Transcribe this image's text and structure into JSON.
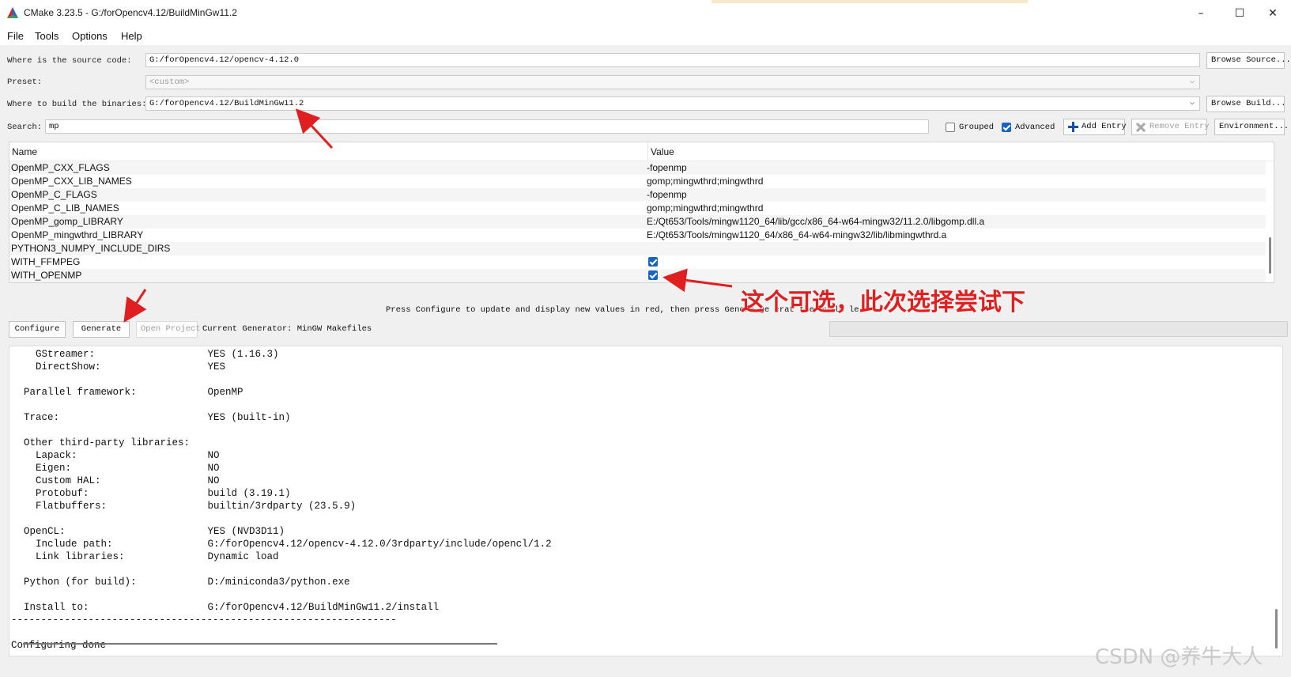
{
  "window": {
    "title": "CMake 3.23.5 - G:/forOpencv4.12/BuildMinGw11.2",
    "minimize": "–",
    "maximize": "☐",
    "close": "✕"
  },
  "menu": [
    "File",
    "Tools",
    "Options",
    "Help"
  ],
  "form": {
    "source_label": "Where is the source code:",
    "source_value": "G:/forOpencv4.12/opencv-4.12.0",
    "browse_source": "Browse Source...",
    "preset_label": "Preset:",
    "preset_value": "<custom>",
    "binaries_label": "Where to build the binaries:",
    "binaries_value": "G:/forOpencv4.12/BuildMinGw11.2",
    "browse_build": "Browse Build...",
    "search_label": "Search:",
    "search_value": "mp",
    "grouped_label": "Grouped",
    "grouped_checked": false,
    "advanced_label": "Advanced",
    "advanced_checked": true,
    "add_entry": "Add Entry",
    "remove_entry": "Remove Entry",
    "environment": "Environment..."
  },
  "table": {
    "col_name": "Name",
    "col_value": "Value",
    "rows": [
      {
        "name": "OpenMP_CXX_FLAGS",
        "value": "-fopenmp"
      },
      {
        "name": "OpenMP_CXX_LIB_NAMES",
        "value": "gomp;mingwthrd;mingwthrd"
      },
      {
        "name": "OpenMP_C_FLAGS",
        "value": "-fopenmp"
      },
      {
        "name": "OpenMP_C_LIB_NAMES",
        "value": "gomp;mingwthrd;mingwthrd"
      },
      {
        "name": "OpenMP_gomp_LIBRARY",
        "value": "E:/Qt653/Tools/mingw1120_64/lib/gcc/x86_64-w64-mingw32/11.2.0/libgomp.dll.a"
      },
      {
        "name": "OpenMP_mingwthrd_LIBRARY",
        "value": "E:/Qt653/Tools/mingw1120_64/x86_64-w64-mingw32/lib/libmingwthrd.a"
      },
      {
        "name": "PYTHON3_NUMPY_INCLUDE_DIRS",
        "value": ""
      },
      {
        "name": "WITH_FFMPEG",
        "value": "",
        "checkbox": true
      },
      {
        "name": "WITH_OPENMP",
        "value": "",
        "checkbox": true
      }
    ]
  },
  "status": {
    "press_text": "Press Configure to update and display new values in red, then press Genera    ge  erat     the build   le",
    "configure": "Configure",
    "generate": "Generate",
    "open_project": "Open Project",
    "current_generator": "Current Generator: MinGW Makefiles"
  },
  "output_lines": [
    "  GStreamer:                   YES (1.16.3)",
    "  DirectShow:                  YES",
    "",
    "Parallel framework:            OpenMP",
    "",
    "Trace:                         YES (built-in)",
    "",
    "Other third-party libraries:",
    "  Lapack:                      NO",
    "  Eigen:                       NO",
    "  Custom HAL:                  NO",
    "  Protobuf:                    build (3.19.1)",
    "  Flatbuffers:                 builtin/3rdparty (23.5.9)",
    "",
    "OpenCL:                        YES (NVD3D11)",
    "  Include path:                G:/forOpencv4.12/opencv-4.12.0/3rdparty/include/opencl/1.2",
    "  Link libraries:              Dynamic load",
    "",
    "Python (for build):            D:/miniconda3/python.exe",
    "",
    "Install to:                    G:/forOpencv4.12/BuildMinGw11.2/install",
    "-----------------------------------------------------------------",
    "",
    "Configuring done"
  ],
  "annotation": {
    "text": "这个可选，此次选择尝试下",
    "color": "#e02020"
  },
  "watermark": "CSDN @养牛大人"
}
